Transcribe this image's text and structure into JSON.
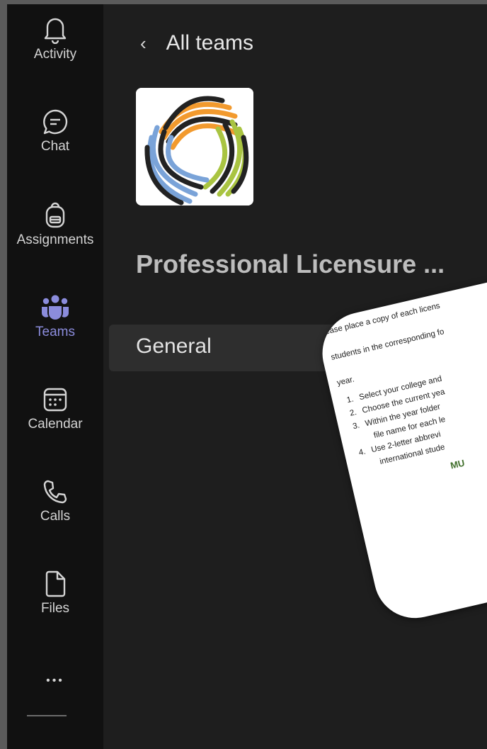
{
  "rail": {
    "items": [
      {
        "label": "Activity",
        "icon": "bell-icon",
        "active": false
      },
      {
        "label": "Chat",
        "icon": "chat-icon",
        "active": false
      },
      {
        "label": "Assignments",
        "icon": "backpack-icon",
        "active": false
      },
      {
        "label": "Teams",
        "icon": "teams-icon",
        "active": true
      },
      {
        "label": "Calendar",
        "icon": "calendar-icon",
        "active": false
      },
      {
        "label": "Calls",
        "icon": "phone-icon",
        "active": false
      },
      {
        "label": "Files",
        "icon": "file-icon",
        "active": false
      }
    ],
    "more_label": "•••",
    "accent": "#8b8cdc"
  },
  "header": {
    "back_label": "All teams",
    "back_icon": "chevron-left-icon"
  },
  "team": {
    "name": "Professional Licensure ...",
    "logo_icon": "swirl-logo-icon"
  },
  "channels": [
    {
      "label": "General",
      "selected": true
    }
  ],
  "document": {
    "line1": "ease place a copy of each licens",
    "line2": "students in the corresponding fo",
    "line3": "year.",
    "steps": [
      {
        "num": "1.",
        "text": "Select your college and"
      },
      {
        "num": "2.",
        "text": "Choose the current yea"
      },
      {
        "num": "3.",
        "text": "Within the year folder"
      },
      {
        "num": "",
        "text": "file name for each le"
      },
      {
        "num": "4.",
        "text": "Use 2-letter abbrevi"
      },
      {
        "num": "",
        "text": "international stude"
      }
    ],
    "highlight": "MU",
    "bullets": [
      "•",
      "•",
      "•"
    ]
  }
}
